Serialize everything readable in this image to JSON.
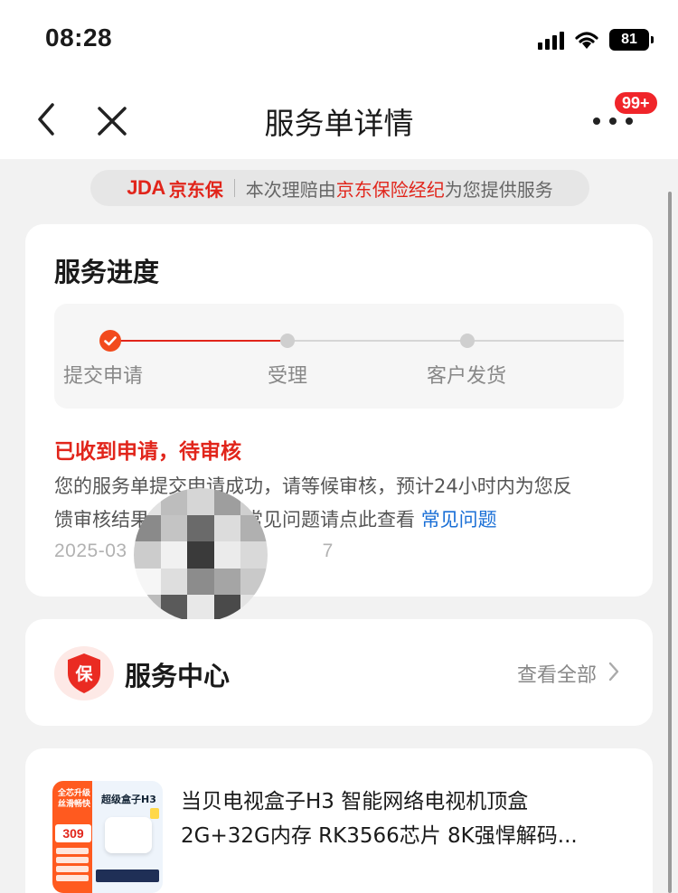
{
  "status_bar": {
    "time": "08:28",
    "battery": "81"
  },
  "nav": {
    "title": "服务单详情",
    "badge": "99+"
  },
  "banner": {
    "logo": "JDA",
    "logo_cn": "京东保",
    "text_before": "本次理赔由",
    "highlight": "京东保险经纪",
    "text_after": "为您提供服务"
  },
  "progress": {
    "title": "服务进度",
    "steps": [
      {
        "label": "提交申请",
        "done": true
      },
      {
        "label": "受理",
        "done": false
      },
      {
        "label": "客户发货",
        "done": false
      }
    ],
    "status_title": "已收到申请，待审核",
    "status_desc_line1": "您的服务单提交申请成功，请等候审核，预计24小时内为您反",
    "status_desc_line2": "馈审核结果，如有疑问常见问题请点此查看",
    "faq_link": "常见问题",
    "date_start": "2025-03",
    "date_end": "7"
  },
  "service_center": {
    "title": "服务中心",
    "shield_char": "保",
    "view_all": "查看全部"
  },
  "product": {
    "title_line1": "当贝电视盒子H3 智能网络电视机顶盒",
    "title_line2": "2G+32G内存 RK3566芯片 8K强悍解码...",
    "image": {
      "tag_line1": "全芯升级",
      "tag_line2": "丝滑畅快",
      "price": "309",
      "name": "超级盒子H3"
    }
  },
  "colors": {
    "brand_red": "#e1251b",
    "link_blue": "#1a6fd6"
  }
}
